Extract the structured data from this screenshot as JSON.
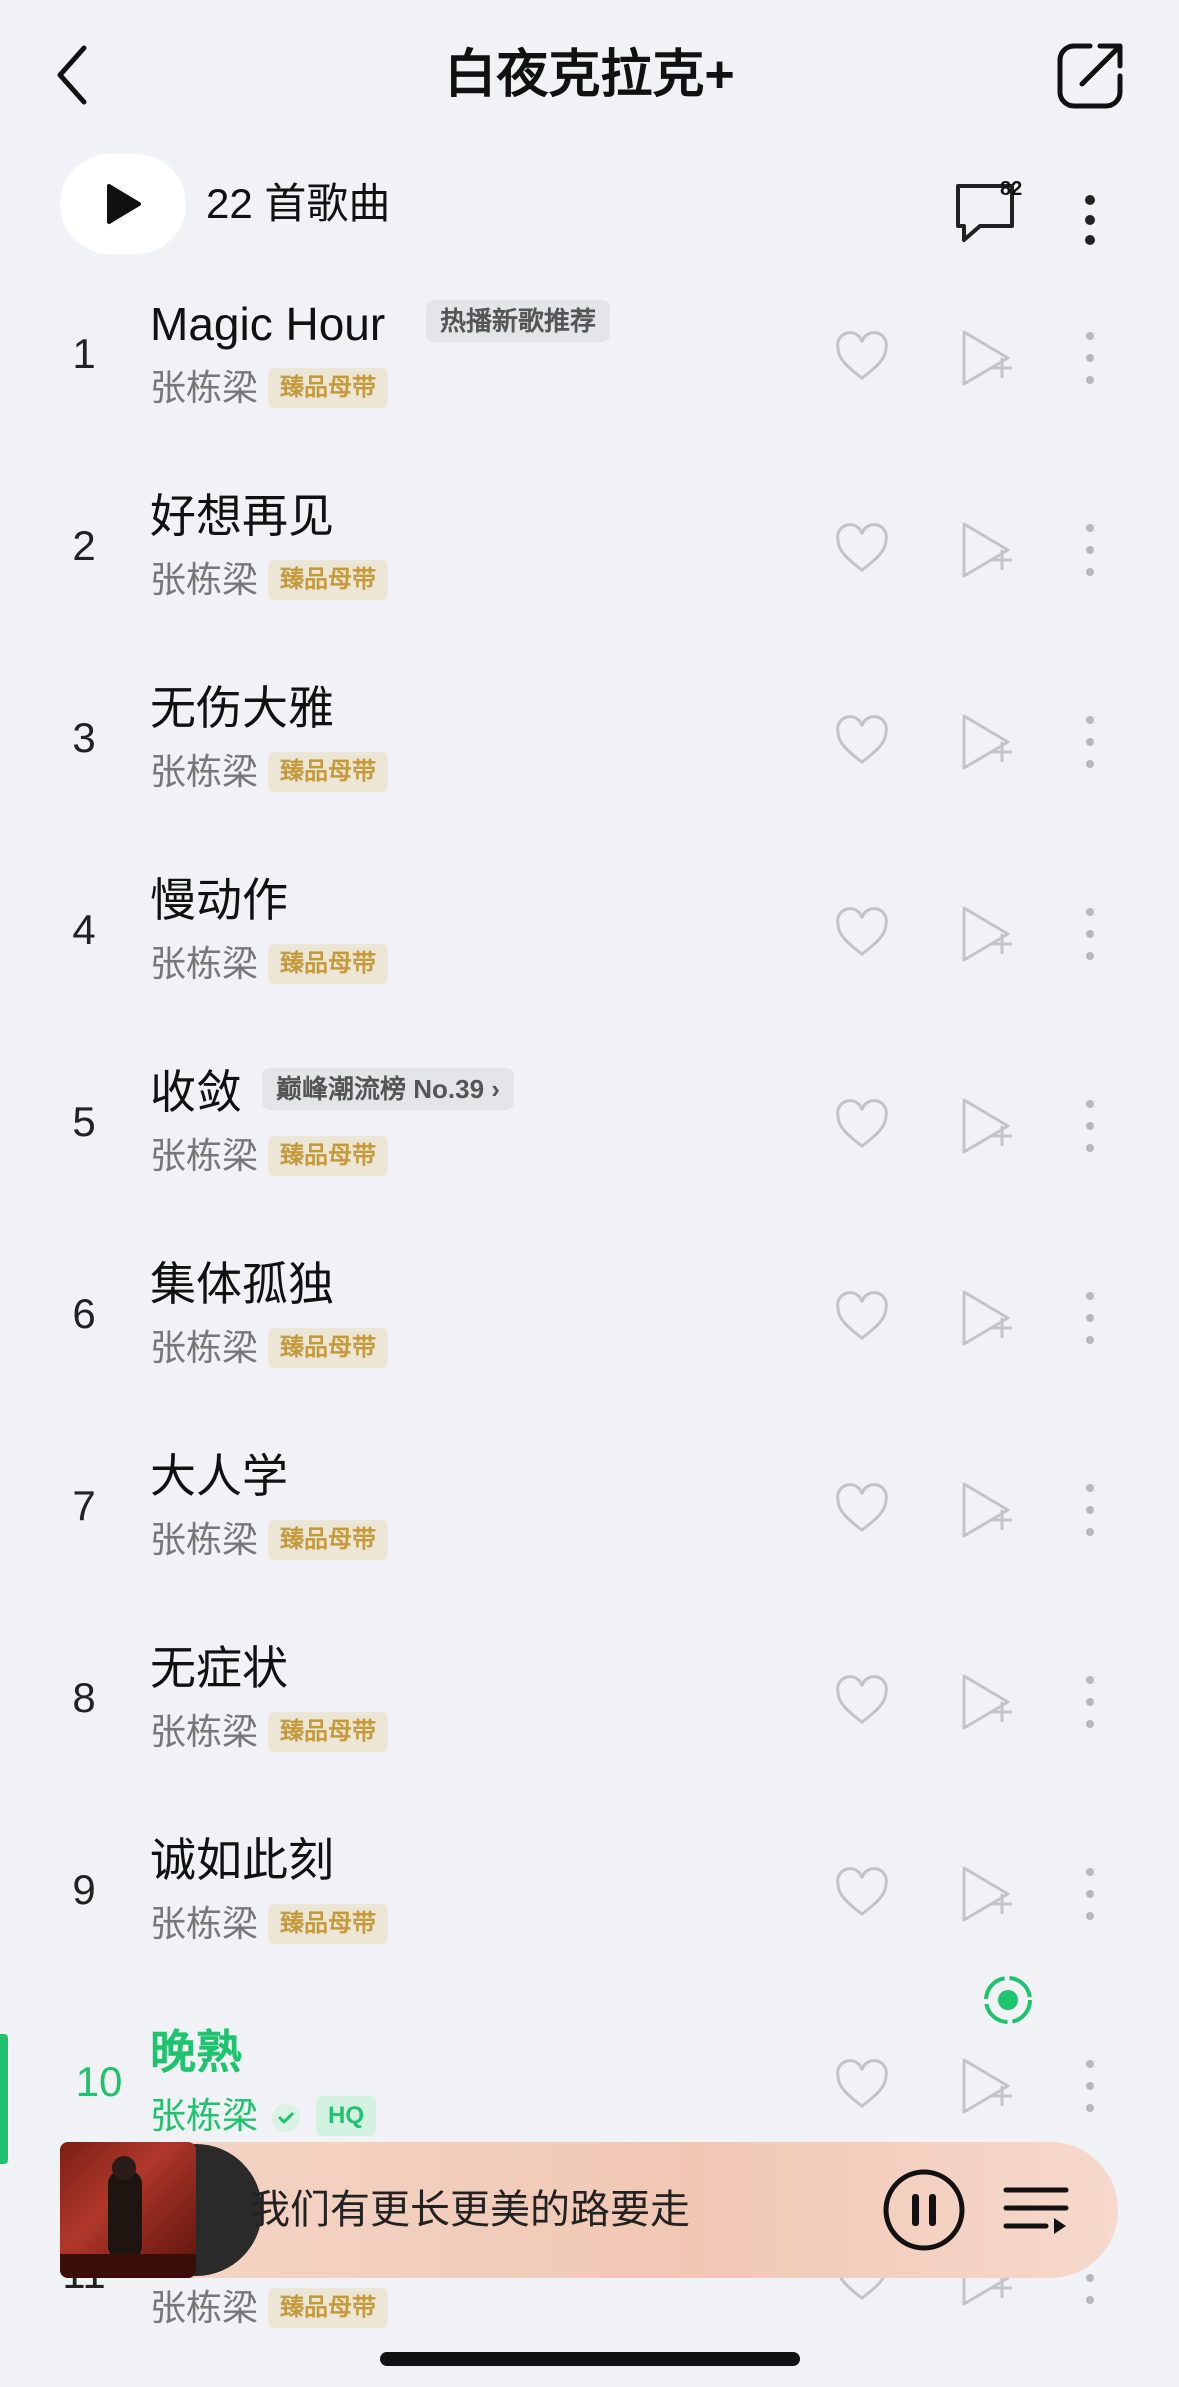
{
  "header": {
    "title": "白夜克拉克+",
    "back_icon": "chevron-left-icon",
    "share_icon": "share-icon"
  },
  "playbar": {
    "count_label": "22 首歌曲",
    "comment_count": "82"
  },
  "songs": [
    {
      "num": "1",
      "title": "Magic Hour",
      "tag": "热播新歌推荐",
      "artist": "张栋梁",
      "badge": "臻品母带"
    },
    {
      "num": "2",
      "title": "好想再见",
      "artist": "张栋梁",
      "badge": "臻品母带"
    },
    {
      "num": "3",
      "title": "无伤大雅",
      "artist": "张栋梁",
      "badge": "臻品母带"
    },
    {
      "num": "4",
      "title": "慢动作",
      "artist": "张栋梁",
      "badge": "臻品母带"
    },
    {
      "num": "5",
      "title": "收敛",
      "tag": "巅峰潮流榜 No.39 ›",
      "artist": "张栋梁",
      "badge": "臻品母带"
    },
    {
      "num": "6",
      "title": "集体孤独",
      "artist": "张栋梁",
      "badge": "臻品母带"
    },
    {
      "num": "7",
      "title": "大人学",
      "artist": "张栋梁",
      "badge": "臻品母带"
    },
    {
      "num": "8",
      "title": "无症状",
      "artist": "张栋梁",
      "badge": "臻品母带"
    },
    {
      "num": "9",
      "title": "诚如此刻",
      "artist": "张栋梁",
      "badge": "臻品母带"
    },
    {
      "num": "10",
      "title": "晚熟",
      "artist": "张栋梁",
      "quality": "HQ",
      "playing": true
    },
    {
      "num": "11",
      "artist": "张栋梁",
      "badge": "臻品母带"
    }
  ],
  "mini_player": {
    "lyric": "我们有更长更美的路要走"
  },
  "colors": {
    "accent": "#1ec36d",
    "gold": "#c49a3a",
    "background": "#f1f2f6"
  }
}
